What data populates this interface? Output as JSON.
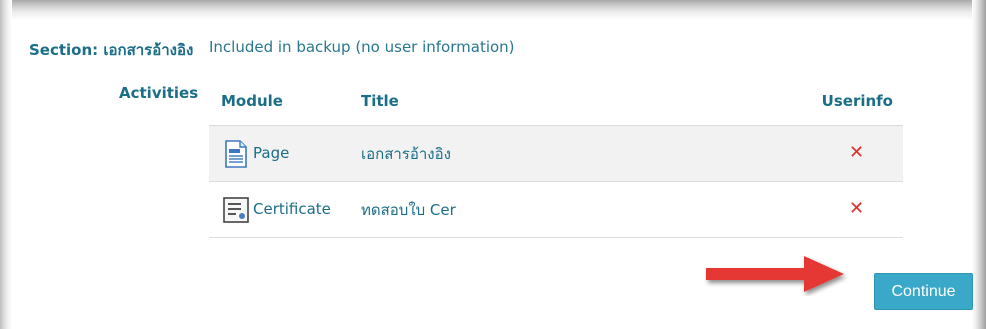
{
  "section": {
    "label": "Section: เอกสารอ้างอิง",
    "value": "Included in backup (no user information)"
  },
  "activities": {
    "label": "Activities",
    "columns": {
      "module": "Module",
      "title": "Title",
      "userinfo": "Userinfo"
    },
    "rows": [
      {
        "module": "Page",
        "title": "เอกสารอ้างอิง",
        "userinfo": "✕",
        "icon": "page-icon"
      },
      {
        "module": "Certificate",
        "title": "ทดสอบใบ Cer",
        "userinfo": "✕",
        "icon": "certificate-icon"
      }
    ]
  },
  "continue_button": {
    "label": "Continue"
  },
  "colors": {
    "heading": "#1b6e87",
    "text": "#2a7790",
    "cross": "#e0302a",
    "button": "#3aa8c9",
    "arrow": "#e53935"
  }
}
